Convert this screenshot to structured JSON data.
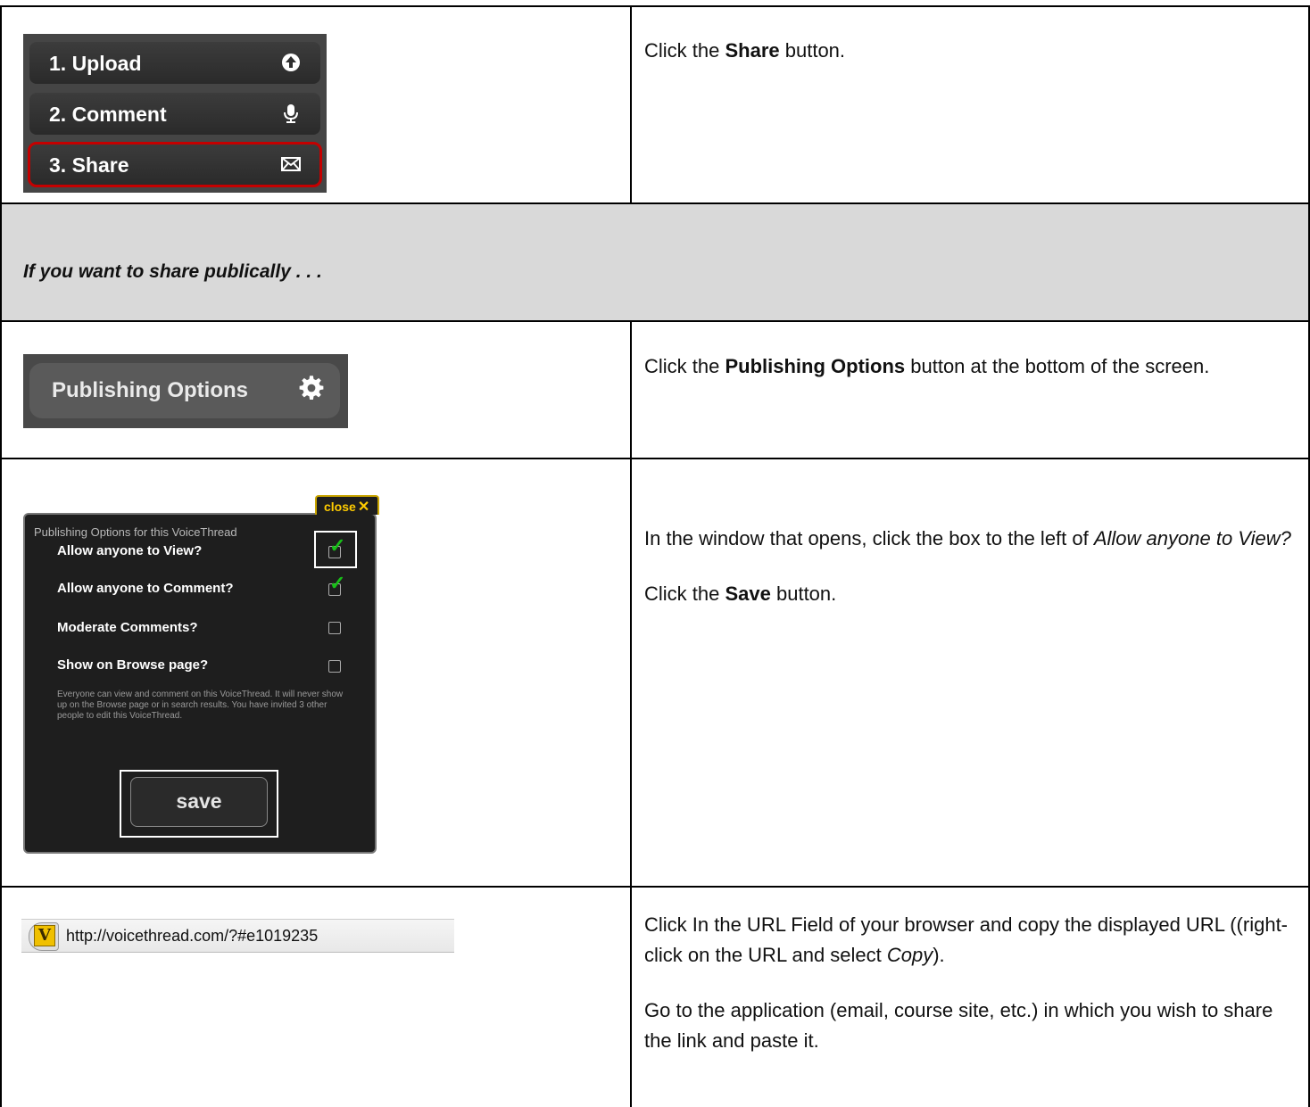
{
  "rows": {
    "share_step": {
      "steps": [
        {
          "label": "1. Upload",
          "icon": "upload-circle-icon"
        },
        {
          "label": "2. Comment",
          "icon": "microphone-icon"
        },
        {
          "label": "3. Share",
          "icon": "envelope-icon",
          "highlighted": true
        }
      ],
      "instruction": {
        "pre": "Click the ",
        "bold": "Share",
        "post": " button."
      }
    },
    "section_band": {
      "text": "If you want to share publically . . ."
    },
    "publishing_step": {
      "button_label": "Publishing Options",
      "button_icon": "gear-icon",
      "instruction": {
        "pre": "Click the ",
        "bold": "Publishing Options",
        "post": " button at the bottom of the screen."
      }
    },
    "dialog_step": {
      "dialog": {
        "title": "Publishing Options for this VoiceThread",
        "close_label": "close",
        "options": [
          {
            "label": "Allow anyone to View?",
            "checked": true
          },
          {
            "label": "Allow anyone to Comment?",
            "checked": true
          },
          {
            "label": "Moderate Comments?",
            "checked": false
          },
          {
            "label": "Show on Browse page?",
            "checked": false
          }
        ],
        "description": "Everyone can view and comment on this VoiceThread. It will never show up on the Browse page or in search results. You have invited 3 other people to edit this VoiceThread.",
        "save_label": "save"
      },
      "instruction1": {
        "pre": "In the window that opens, click the box to the left of ",
        "italic": "Allow anyone to View?"
      },
      "instruction2": {
        "pre": "Click the ",
        "bold": "Save",
        "post": " button."
      }
    },
    "url_step": {
      "url": "http://voicethread.com/?#e1019235",
      "site_badge": "V",
      "instruction1": {
        "pre": "Click In the URL Field of your browser and copy the displayed URL ((right-click on the URL and select ",
        "italic": "Copy",
        "post": ")."
      },
      "instruction2": "Go to the application (email, course site, etc.) in which you wish to share the link and paste it."
    }
  },
  "colors": {
    "highlight_red": "#c40000",
    "checkmark_green": "#18c018",
    "close_yellow": "#ffcc00",
    "band_gray": "#d9d9d9"
  }
}
